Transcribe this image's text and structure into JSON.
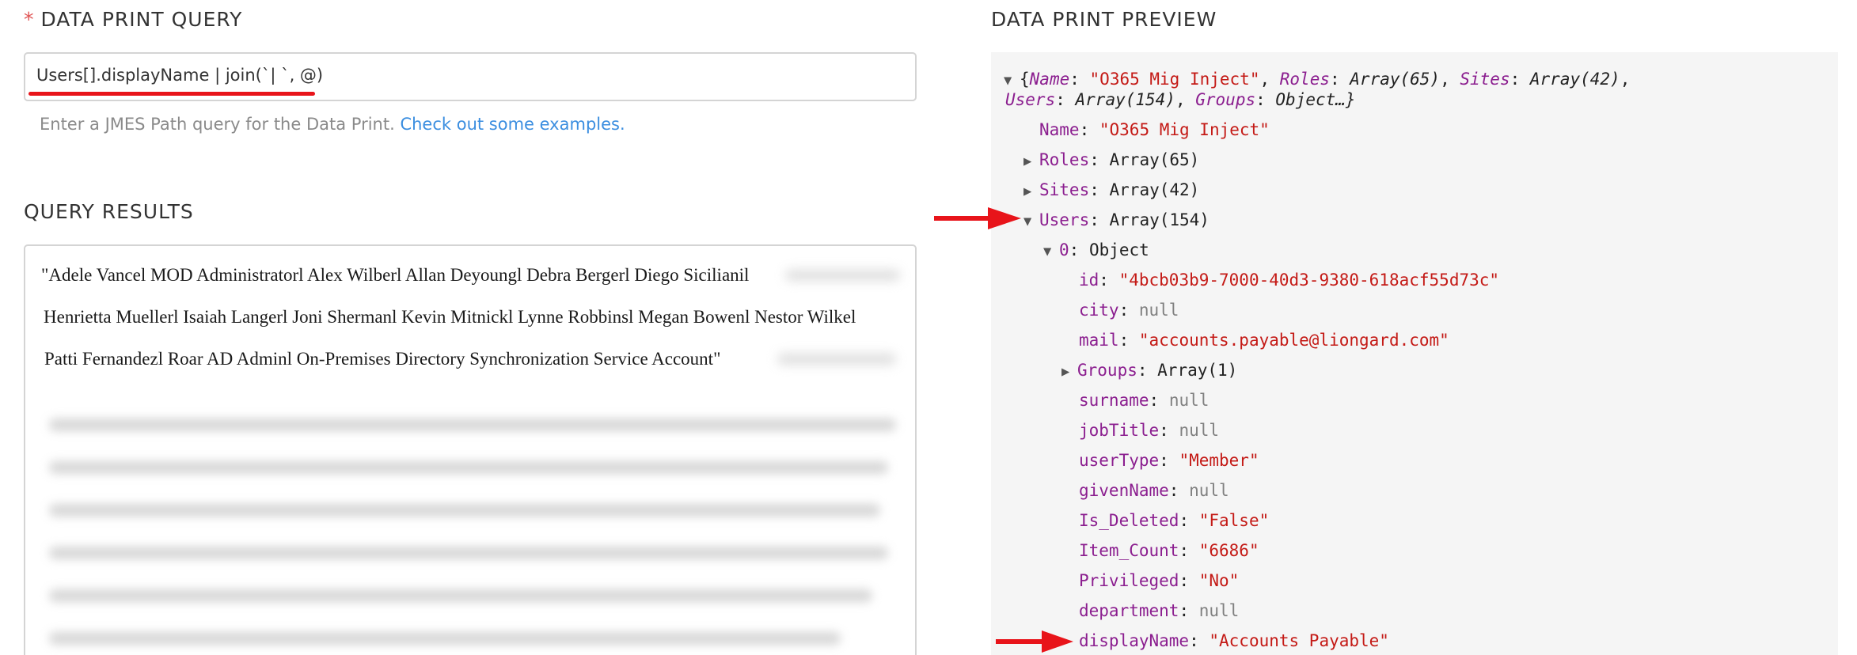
{
  "query_section": {
    "required_marker": "*",
    "label": "DATA PRINT QUERY",
    "input_value": "Users[].displayName | join(`| `, @)",
    "help_text": "Enter a JMES Path query for the Data Print.",
    "help_link": "Check out some examples."
  },
  "results_section": {
    "label": "QUERY RESULTS",
    "lines": [
      "\"Adele Vancel MOD Administratorl Alex Wilberl Allan Deyoungl Debra Bergerl Diego Sicilianil",
      "Henrietta Muellerl Isaiah Langerl Joni Shermanl Kevin Mitnickl Lynne Robbinsl Megan Bowenl Nestor Wilkel",
      "Patti Fernandezl Roar AD Adminl On-Premises Directory Synchronization Service Account\""
    ]
  },
  "preview_section": {
    "label": "DATA PRINT PREVIEW",
    "colors": {
      "key": "#8b1e8f",
      "string": "#c41a16",
      "null": "#808080",
      "arrow": "#e8141a"
    },
    "summary_line1": {
      "open": "{",
      "name_key": "Name",
      "name_val": "\"O365 Mig Inject\"",
      "roles_key": "Roles",
      "roles_val": "Array(65)",
      "sites_key": "Sites",
      "sites_val": "Array(42)"
    },
    "summary_line2": {
      "users_key": "Users",
      "users_val": "Array(154)",
      "groups_key": "Groups",
      "groups_val": "Object…}"
    },
    "rows": {
      "name": {
        "key": "Name",
        "value": "\"O365 Mig Inject\""
      },
      "roles": {
        "key": "Roles",
        "value": "Array(65)"
      },
      "sites": {
        "key": "Sites",
        "value": "Array(42)"
      },
      "users": {
        "key": "Users",
        "value": "Array(154)"
      },
      "item0": {
        "key": "0",
        "value": "Object"
      },
      "id": {
        "key": "id",
        "value": "\"4bcb03b9-7000-40d3-9380-618acf55d73c\""
      },
      "city": {
        "key": "city",
        "value": "null"
      },
      "mail": {
        "key": "mail",
        "value": "\"accounts.payable@liongard.com\""
      },
      "groups": {
        "key": "Groups",
        "value": "Array(1)"
      },
      "surname": {
        "key": "surname",
        "value": "null"
      },
      "jobTitle": {
        "key": "jobTitle",
        "value": "null"
      },
      "userType": {
        "key": "userType",
        "value": "\"Member\""
      },
      "givenName": {
        "key": "givenName",
        "value": "null"
      },
      "isDeleted": {
        "key": "Is_Deleted",
        "value": "\"False\""
      },
      "itemCount": {
        "key": "Item_Count",
        "value": "\"6686\""
      },
      "privileged": {
        "key": "Privileged",
        "value": "\"No\""
      },
      "department": {
        "key": "department",
        "value": "null"
      },
      "displayName": {
        "key": "displayName",
        "value": "\"Accounts Payable\""
      }
    },
    "icons": {
      "expanded": "triangle-down-icon",
      "collapsed": "triangle-right-icon",
      "annotation": "red-arrow-icon"
    }
  }
}
